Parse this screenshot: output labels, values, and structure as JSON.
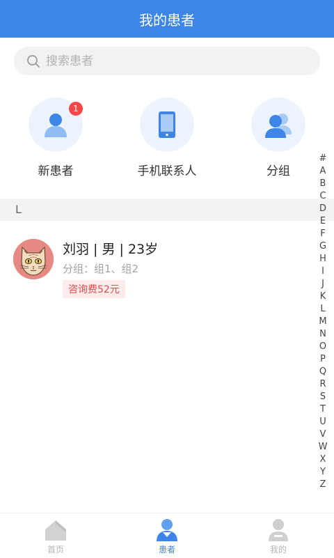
{
  "header": {
    "title": "我的患者"
  },
  "search": {
    "placeholder": "搜索患者",
    "icon": "search-icon"
  },
  "quick_actions": [
    {
      "label": "新患者",
      "icon": "person-icon",
      "badge": "1"
    },
    {
      "label": "手机联系人",
      "icon": "phone-icon"
    },
    {
      "label": "分组",
      "icon": "group-icon"
    }
  ],
  "section": {
    "letter": "L"
  },
  "patients": [
    {
      "name": "刘羽 | 男 | 23岁",
      "group": "分组：组1、组2",
      "fee": "咨询费52元",
      "avatar": "cat-avatar"
    }
  ],
  "index_letters": [
    "#",
    "A",
    "B",
    "C",
    "D",
    "E",
    "F",
    "G",
    "H",
    "I",
    "J",
    "K",
    "L",
    "M",
    "N",
    "O",
    "P",
    "Q",
    "R",
    "S",
    "T",
    "U",
    "V",
    "W",
    "X",
    "Y",
    "Z"
  ],
  "tabs": [
    {
      "label": "首页",
      "icon": "home-icon",
      "active": false
    },
    {
      "label": "患者",
      "icon": "patient-icon",
      "active": true
    },
    {
      "label": "我的",
      "icon": "profile-icon",
      "active": false
    }
  ],
  "colors": {
    "primary": "#3d86e8",
    "badge": "#f24848",
    "fee_text": "#e44c4c",
    "fee_bg": "#fdecec"
  }
}
